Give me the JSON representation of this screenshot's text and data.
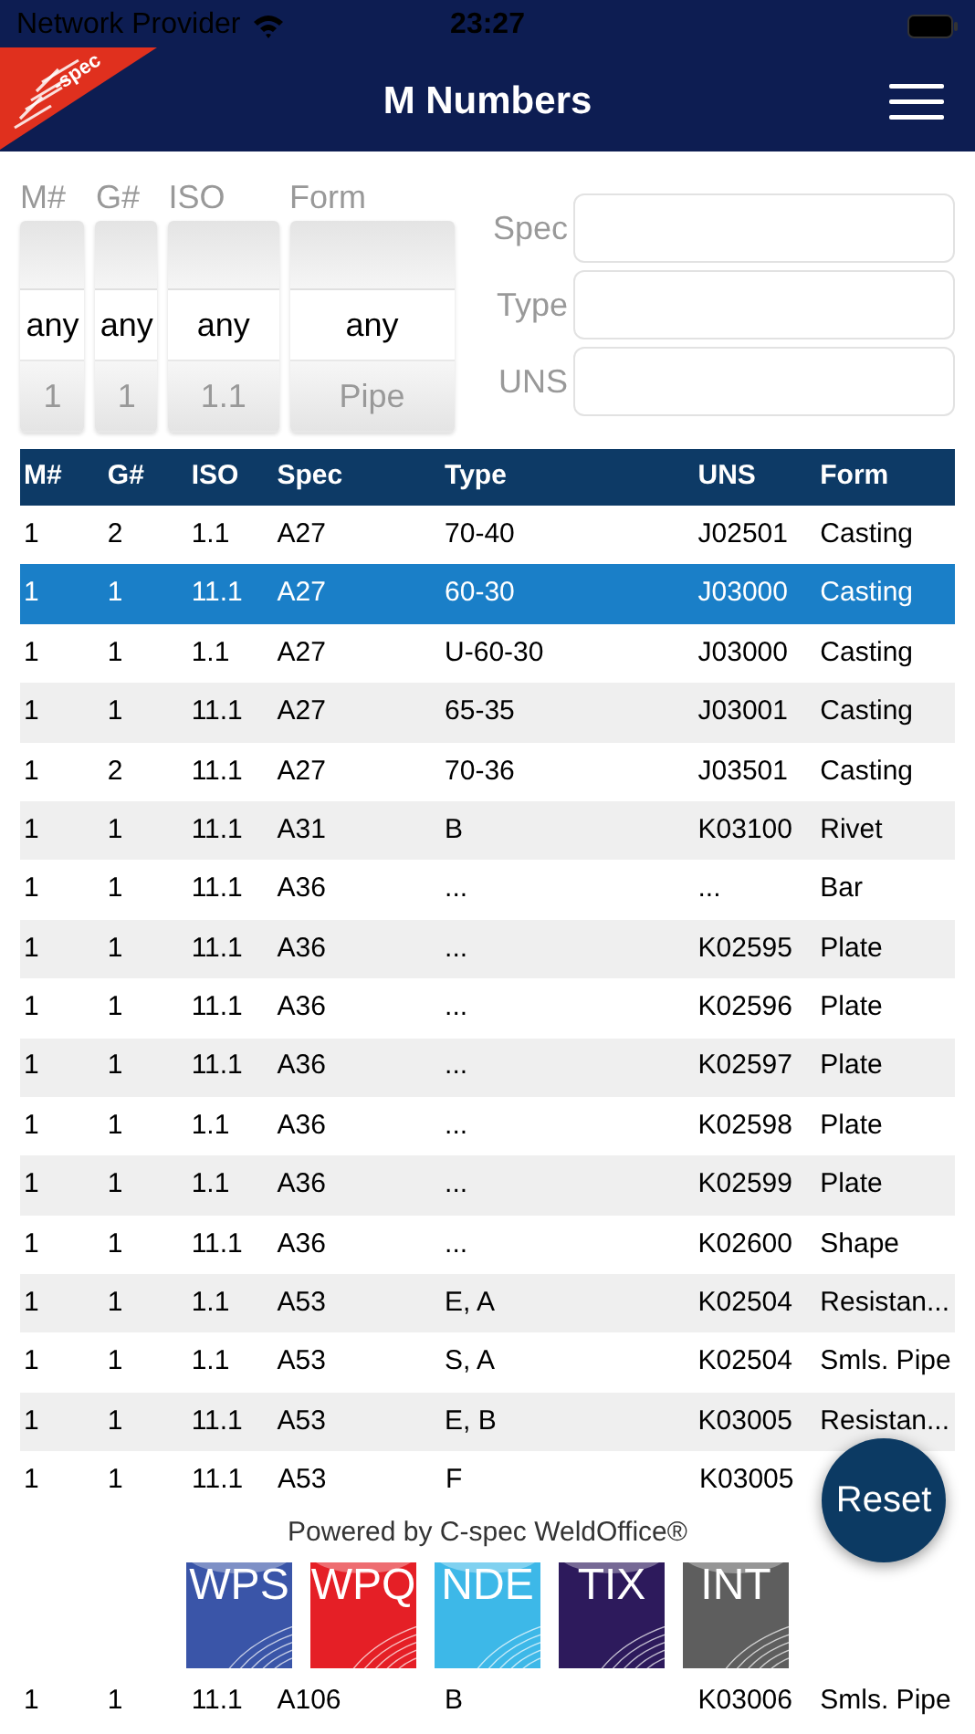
{
  "status_bar": {
    "carrier": "Network Provider",
    "time": "23:27"
  },
  "header": {
    "logo_text": "-spec",
    "title": "M Numbers"
  },
  "pickers": [
    {
      "label": "M#",
      "options": [
        {
          "text": "any",
          "selected": true
        },
        {
          "text": "1",
          "selected": false
        }
      ]
    },
    {
      "label": "G#",
      "options": [
        {
          "text": "any",
          "selected": true
        },
        {
          "text": "1",
          "selected": false
        }
      ]
    },
    {
      "label": "ISO",
      "options": [
        {
          "text": "any",
          "selected": true
        },
        {
          "text": "1.1",
          "selected": false
        }
      ]
    },
    {
      "label": "Form",
      "options": [
        {
          "text": "any",
          "selected": true
        },
        {
          "text": "Pipe",
          "selected": false
        }
      ]
    }
  ],
  "filters": [
    {
      "label": "Spec"
    },
    {
      "label": "Type"
    },
    {
      "label": "UNS"
    }
  ],
  "table": {
    "columns": [
      "M#",
      "G#",
      "ISO",
      "Spec",
      "Type",
      "UNS",
      "Form"
    ],
    "rows": [
      {
        "cells": [
          "1",
          "2",
          "1.1",
          "A27",
          "70-40",
          "J02501",
          "Casting"
        ],
        "selected": false
      },
      {
        "cells": [
          "1",
          "1",
          "11.1",
          "A27",
          "60-30",
          "J03000",
          "Casting"
        ],
        "selected": true
      },
      {
        "cells": [
          "1",
          "1",
          "1.1",
          "A27",
          "U-60-30",
          "J03000",
          "Casting"
        ],
        "selected": false
      },
      {
        "cells": [
          "1",
          "1",
          "11.1",
          "A27",
          "65-35",
          "J03001",
          "Casting"
        ],
        "selected": false
      },
      {
        "cells": [
          "1",
          "2",
          "11.1",
          "A27",
          "70-36",
          "J03501",
          "Casting"
        ],
        "selected": false
      },
      {
        "cells": [
          "1",
          "1",
          "11.1",
          "A31",
          "B",
          "K03100",
          "Rivet"
        ],
        "selected": false
      },
      {
        "cells": [
          "1",
          "1",
          "11.1",
          "A36",
          "...",
          "...",
          "Bar"
        ],
        "selected": false
      },
      {
        "cells": [
          "1",
          "1",
          "11.1",
          "A36",
          "...",
          "K02595",
          "Plate"
        ],
        "selected": false
      },
      {
        "cells": [
          "1",
          "1",
          "11.1",
          "A36",
          "...",
          "K02596",
          "Plate"
        ],
        "selected": false
      },
      {
        "cells": [
          "1",
          "1",
          "11.1",
          "A36",
          "...",
          "K02597",
          "Plate"
        ],
        "selected": false
      },
      {
        "cells": [
          "1",
          "1",
          "1.1",
          "A36",
          "...",
          "K02598",
          "Plate"
        ],
        "selected": false
      },
      {
        "cells": [
          "1",
          "1",
          "1.1",
          "A36",
          "...",
          "K02599",
          "Plate"
        ],
        "selected": false
      },
      {
        "cells": [
          "1",
          "1",
          "11.1",
          "A36",
          "...",
          "K02600",
          "Shape"
        ],
        "selected": false
      },
      {
        "cells": [
          "1",
          "1",
          "1.1",
          "A53",
          "E, A",
          "K02504",
          "Resistan..."
        ],
        "selected": false
      },
      {
        "cells": [
          "1",
          "1",
          "1.1",
          "A53",
          "S, A",
          "K02504",
          "Smls. Pipe"
        ],
        "selected": false
      },
      {
        "cells": [
          "1",
          "1",
          "11.1",
          "A53",
          "E, B",
          "K03005",
          "Resistan..."
        ],
        "selected": false
      },
      {
        "cells": [
          "1",
          "1",
          "11.1",
          "A53",
          "F",
          "K03005"
        ],
        "selected": false
      }
    ],
    "bottom_row": {
      "cells": [
        "1",
        "1",
        "11.1",
        "A106",
        "B",
        "K03006",
        "Smls. Pipe"
      ],
      "selected": false
    }
  },
  "reset_button": "Reset",
  "footer": {
    "text": "Powered by C-spec WeldOffice®",
    "tiles": [
      {
        "label": "WPS",
        "color": "#3a55a8"
      },
      {
        "label": "WPQ",
        "color": "#e51f26"
      },
      {
        "label": "NDE",
        "color": "#3db8e8"
      },
      {
        "label": "TIX",
        "color": "#2d1a5c"
      },
      {
        "label": "INT",
        "color": "#5e5e5e"
      }
    ]
  }
}
